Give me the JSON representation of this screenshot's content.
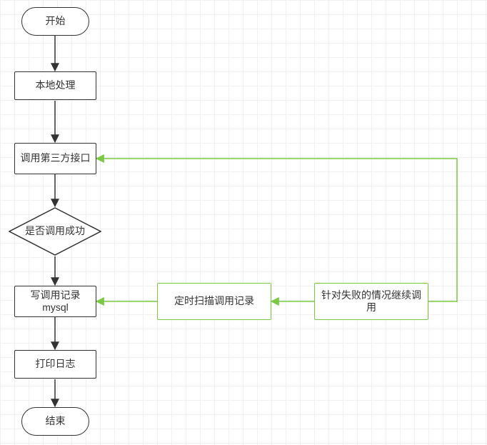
{
  "chart_data": {
    "type": "flowchart",
    "nodes": [
      {
        "id": "start",
        "kind": "terminator",
        "label": "开始"
      },
      {
        "id": "local",
        "kind": "process",
        "label": "本地处理"
      },
      {
        "id": "call3p",
        "kind": "process",
        "label": "调用第三方接口"
      },
      {
        "id": "success",
        "kind": "decision",
        "label": "是否调用成功"
      },
      {
        "id": "writedb",
        "kind": "process",
        "label": "写调用记录mysql"
      },
      {
        "id": "log",
        "kind": "process",
        "label": "打印日志"
      },
      {
        "id": "end",
        "kind": "terminator",
        "label": "结束"
      },
      {
        "id": "scan",
        "kind": "process-green",
        "label": "定时扫描调用记录"
      },
      {
        "id": "retry",
        "kind": "process-green",
        "label": "针对失败的情况继续调用"
      }
    ],
    "edges": [
      {
        "from": "start",
        "to": "local",
        "color": "black"
      },
      {
        "from": "local",
        "to": "call3p",
        "color": "black"
      },
      {
        "from": "call3p",
        "to": "success",
        "color": "black"
      },
      {
        "from": "success",
        "to": "writedb",
        "color": "black"
      },
      {
        "from": "writedb",
        "to": "log",
        "color": "black"
      },
      {
        "from": "log",
        "to": "end",
        "color": "black"
      },
      {
        "from": "scan",
        "to": "writedb",
        "color": "green"
      },
      {
        "from": "retry",
        "to": "scan",
        "color": "green"
      },
      {
        "from": "retry",
        "to": "call3p",
        "color": "green"
      }
    ]
  },
  "nodes": {
    "start": {
      "label": "开始"
    },
    "local": {
      "label": "本地处理"
    },
    "call3p": {
      "label": "调用第三方接口"
    },
    "success": {
      "label": "是否调用成功"
    },
    "writedb": {
      "label": "写调用记录mysql"
    },
    "log": {
      "label": "打印日志"
    },
    "end": {
      "label": "结束"
    },
    "scan": {
      "label": "定时扫描调用记录"
    },
    "retry": {
      "label": "针对失败的情况继续调用"
    }
  }
}
